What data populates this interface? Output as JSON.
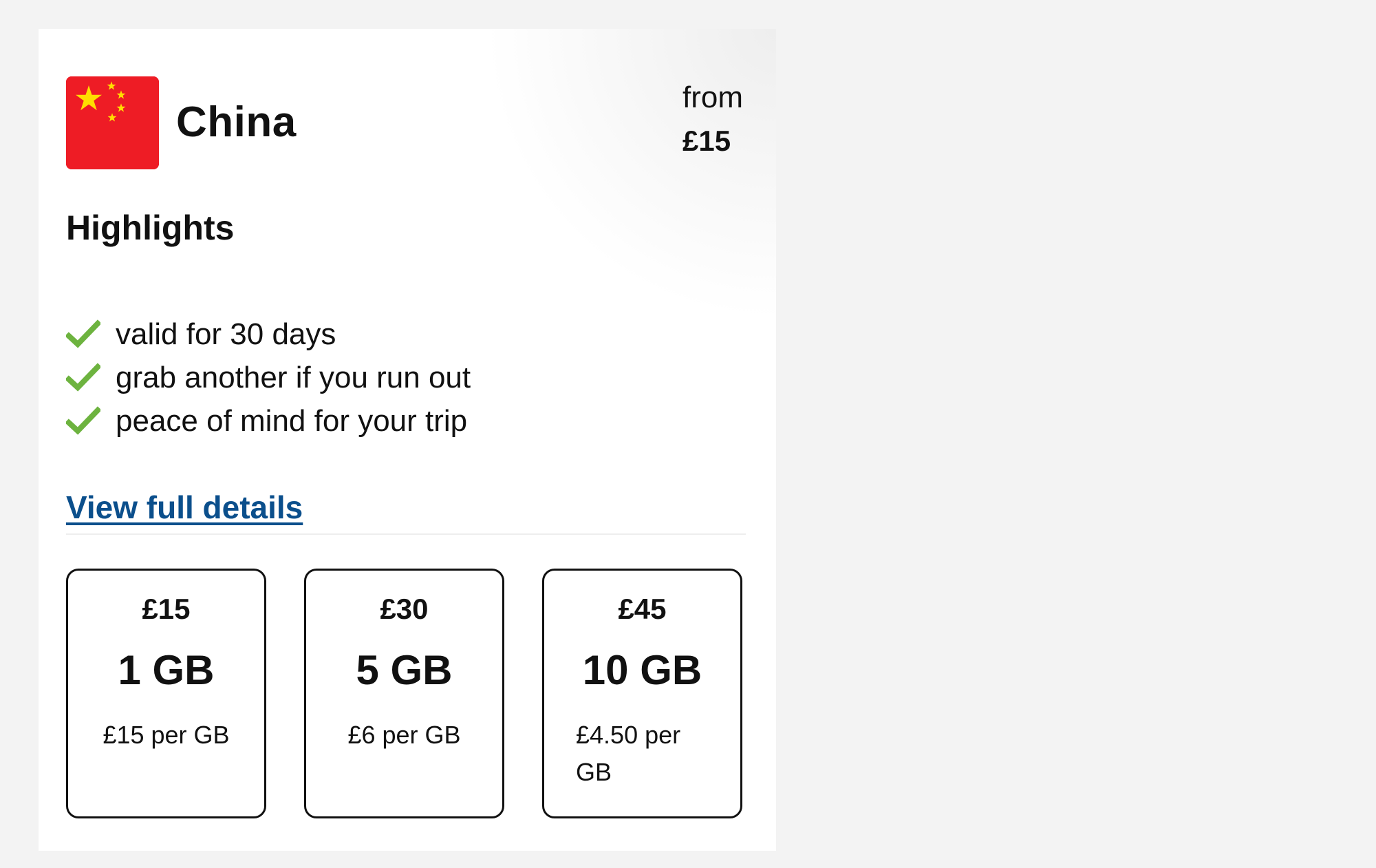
{
  "country": {
    "name": "China",
    "flag_icon": "china-flag-icon",
    "flag_colors": {
      "field": "#ee1c25",
      "stars": "#ffde00"
    }
  },
  "price_from": {
    "label": "from",
    "value": "£15"
  },
  "highlights": {
    "title": "Highlights",
    "check_icon": "green-check-icon",
    "check_color": "#6db33f",
    "items": [
      "valid for 30 days",
      "grab another if you run out",
      "peace of mind for your trip"
    ]
  },
  "details_link": {
    "label": "View full details",
    "color": "#0b4f8c"
  },
  "plans": [
    {
      "price": "£15",
      "data": "1 GB",
      "per_gb": "£15 per GB"
    },
    {
      "price": "£30",
      "data": "5 GB",
      "per_gb": "£6 per GB"
    },
    {
      "price": "£45",
      "data": "10 GB",
      "per_gb": "£4.50 per GB"
    }
  ]
}
